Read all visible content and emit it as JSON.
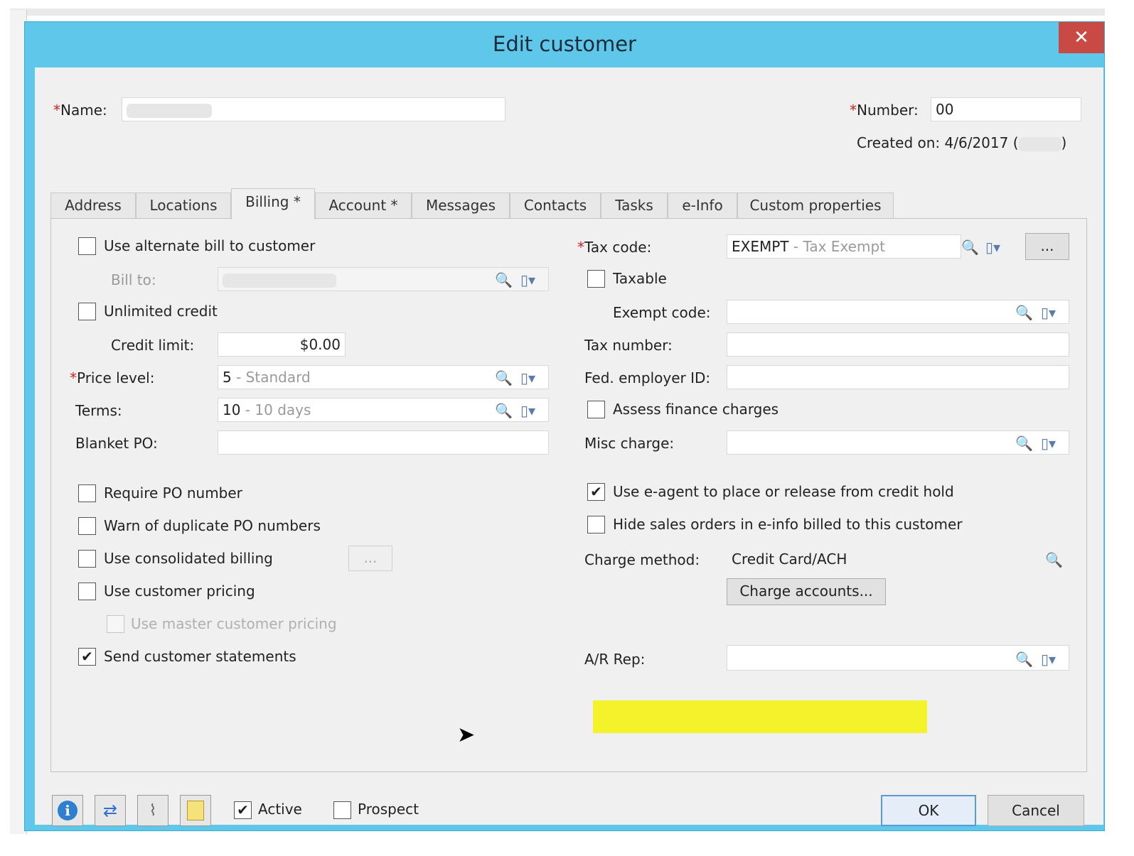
{
  "window": {
    "title": "Edit customer",
    "close_glyph": "✕"
  },
  "header": {
    "name_label": "Name:",
    "name_value": "",
    "number_label": "Number:",
    "number_value": "00",
    "created_on": "Created on: 4/6/2017 (",
    "created_on_suffix": ")"
  },
  "tabs": [
    {
      "label": "Address"
    },
    {
      "label": "Locations"
    },
    {
      "label": "Billing *"
    },
    {
      "label": "Account *"
    },
    {
      "label": "Messages"
    },
    {
      "label": "Contacts"
    },
    {
      "label": "Tasks"
    },
    {
      "label": "e-Info"
    },
    {
      "label": "Custom properties"
    }
  ],
  "billing": {
    "use_alt_bill": {
      "label": "Use alternate bill to customer",
      "checked": false
    },
    "bill_to_label": "Bill to:",
    "unlimited_credit": {
      "label": "Unlimited credit",
      "checked": false
    },
    "credit_limit_label": "Credit limit:",
    "credit_limit_value": "$0.00",
    "price_level_label": "Price level:",
    "price_level_code": "5",
    "price_level_desc": " - Standard",
    "terms_label": "Terms:",
    "terms_code": "10",
    "terms_desc": " - 10 days",
    "blanket_po_label": "Blanket PO:",
    "require_po": {
      "label": "Require PO number",
      "checked": false
    },
    "warn_dup_po": {
      "label": "Warn of duplicate PO numbers",
      "checked": false
    },
    "consolidated_billing": {
      "label": "Use consolidated billing",
      "checked": false
    },
    "consolidated_btn": "...",
    "customer_pricing": {
      "label": "Use customer pricing",
      "checked": false
    },
    "master_pricing": {
      "label": "Use master customer pricing",
      "checked": false
    },
    "send_statements": {
      "label": "Send customer statements",
      "checked": true
    },
    "tax_code_label": "Tax code:",
    "tax_code_code": "EXEMPT",
    "tax_code_desc": " - Tax Exempt",
    "tax_code_btn": "...",
    "taxable": {
      "label": "Taxable",
      "checked": false
    },
    "exempt_code_label": "Exempt code:",
    "tax_number_label": "Tax number:",
    "fed_employer_label": "Fed. employer ID:",
    "assess_finance": {
      "label": "Assess finance charges",
      "checked": false
    },
    "misc_charge_label": "Misc charge:",
    "e_agent": {
      "label": "Use e-agent to place or release from credit hold",
      "checked": true
    },
    "hide_sales_orders": {
      "label": "Hide sales orders in e-info billed to this customer",
      "checked": false
    },
    "charge_method_label": "Charge method:",
    "charge_method_value": "Credit Card/ACH",
    "charge_accounts_btn": "Charge accounts...",
    "ar_rep_label": "A/R Rep:"
  },
  "footer": {
    "active": {
      "label": "Active",
      "checked": true
    },
    "prospect": {
      "label": "Prospect",
      "checked": false
    },
    "ok": "OK",
    "cancel": "Cancel"
  },
  "glyphs": {
    "check": "✔",
    "lookup": "🔍",
    "dropdown": "▯▾"
  },
  "colors": {
    "title_bar": "#5ec7ea",
    "close": "#c94a45",
    "highlight": "#f4f22b",
    "required": "#d41f1f"
  }
}
